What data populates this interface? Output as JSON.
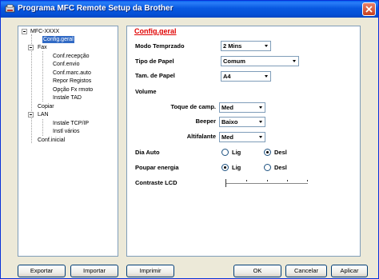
{
  "window": {
    "title": "Programa MFC Remote Setup da Brother"
  },
  "tree": {
    "root": "MFC-XXXX",
    "items": [
      {
        "label": "Config.geral",
        "selected": true
      },
      {
        "label": "Fax"
      },
      {
        "label": "Conf.recepção"
      },
      {
        "label": "Conf.envio"
      },
      {
        "label": "Conf.marc.auto"
      },
      {
        "label": "Repor Registos"
      },
      {
        "label": "Opção Fx rmoto"
      },
      {
        "label": "Instale TAD"
      },
      {
        "label": "Copiar"
      },
      {
        "label": "LAN"
      },
      {
        "label": "Instale TCP/IP"
      },
      {
        "label": "Instl vários"
      },
      {
        "label": "Conf.inicial"
      }
    ]
  },
  "main": {
    "section_title": "Config.geral",
    "modo_temp": {
      "label": "Modo Temprzado",
      "value": "2 Mins"
    },
    "tipo_papel": {
      "label": "Tipo de Papel",
      "value": "Comum"
    },
    "tam_papel": {
      "label": "Tam. de Papel",
      "value": "A4"
    },
    "volume": {
      "label": "Volume"
    },
    "toque": {
      "label": "Toque de camp.",
      "value": "Med"
    },
    "beeper": {
      "label": "Beeper",
      "value": "Baixo"
    },
    "altifalante": {
      "label": "Altifalante",
      "value": "Med"
    },
    "dia_auto": {
      "label": "Dia Auto",
      "option_on": "Lig",
      "option_off": "Desl",
      "selected": "Desl"
    },
    "poupar": {
      "label": "Poupar energia",
      "option_on": "Lig",
      "option_off": "Desl",
      "selected": "Lig"
    },
    "contraste": {
      "label": "Contraste LCD",
      "level": 0
    }
  },
  "buttons": {
    "exportar": "Exportar",
    "importar": "Importar",
    "imprimir": "Imprimir",
    "ok": "OK",
    "cancelar": "Cancelar",
    "aplicar": "Aplicar"
  },
  "colors": {
    "title_bar": "#0558e0",
    "section_title": "#e00000",
    "selection": "#316ac5"
  }
}
